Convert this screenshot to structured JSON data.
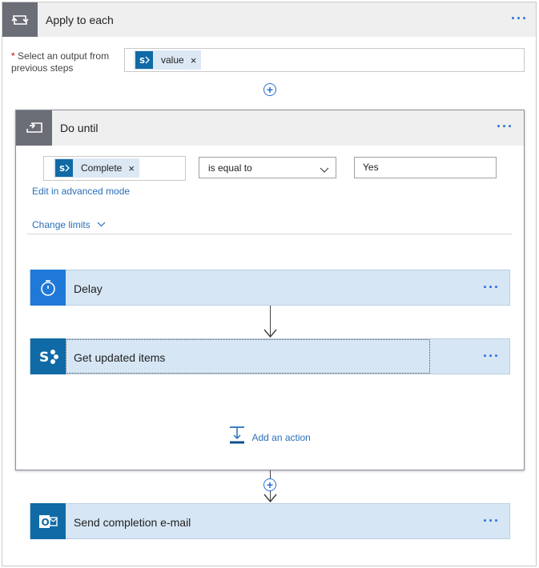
{
  "apply_to_each": {
    "title": "Apply to each",
    "more": "···",
    "required_label": "Select an output from previous steps",
    "required_star": "*",
    "token": {
      "label": "value",
      "remove": "×"
    }
  },
  "do_until": {
    "title": "Do until",
    "more": "···",
    "condition": {
      "left_token": {
        "label": "Complete",
        "remove": "×"
      },
      "operator": "is equal to",
      "right_value": "Yes"
    },
    "advanced_link": "Edit in advanced mode",
    "change_limits": "Change limits",
    "actions": [
      {
        "title": "Delay",
        "more": "···"
      },
      {
        "title": "Get updated items",
        "more": "···"
      }
    ],
    "add_action": "Add an action"
  },
  "send_email": {
    "title": "Send completion e-mail",
    "more": "···"
  },
  "colors": {
    "accent": "#2a6fdb",
    "sharepoint": "#0f6aa5",
    "outlook": "#0f6aa5",
    "delay": "#1f79d8",
    "action_bg": "#d6e6f5"
  }
}
